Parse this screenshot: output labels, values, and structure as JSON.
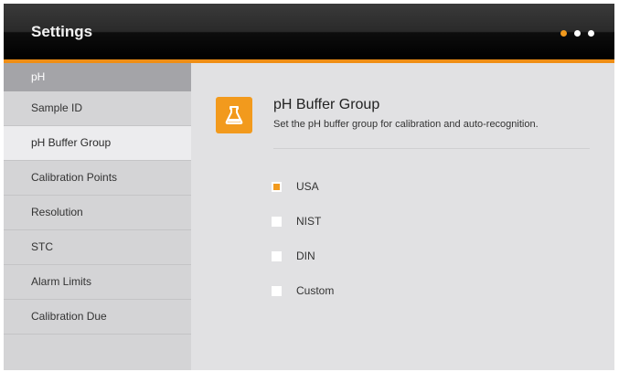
{
  "window": {
    "title": "Settings"
  },
  "pager": {
    "count": 3,
    "active_index": 0
  },
  "colors": {
    "accent": "#f29a1d",
    "titlebar": "#000000",
    "sidebar": "#d4d4d6",
    "content": "#e1e1e3"
  },
  "sidebar": {
    "header": "pH",
    "items": [
      {
        "label": "Sample ID",
        "selected": false
      },
      {
        "label": "pH Buffer Group",
        "selected": true
      },
      {
        "label": "Calibration Points",
        "selected": false
      },
      {
        "label": "Resolution",
        "selected": false
      },
      {
        "label": "STC",
        "selected": false
      },
      {
        "label": "Alarm Limits",
        "selected": false
      },
      {
        "label": "Calibration Due",
        "selected": false
      }
    ]
  },
  "main": {
    "icon": "beaker-icon",
    "title": "pH Buffer Group",
    "description": "Set the pH buffer group for calibration and auto-recognition.",
    "options": [
      {
        "label": "USA",
        "selected": true
      },
      {
        "label": "NIST",
        "selected": false
      },
      {
        "label": "DIN",
        "selected": false
      },
      {
        "label": "Custom",
        "selected": false
      }
    ]
  }
}
